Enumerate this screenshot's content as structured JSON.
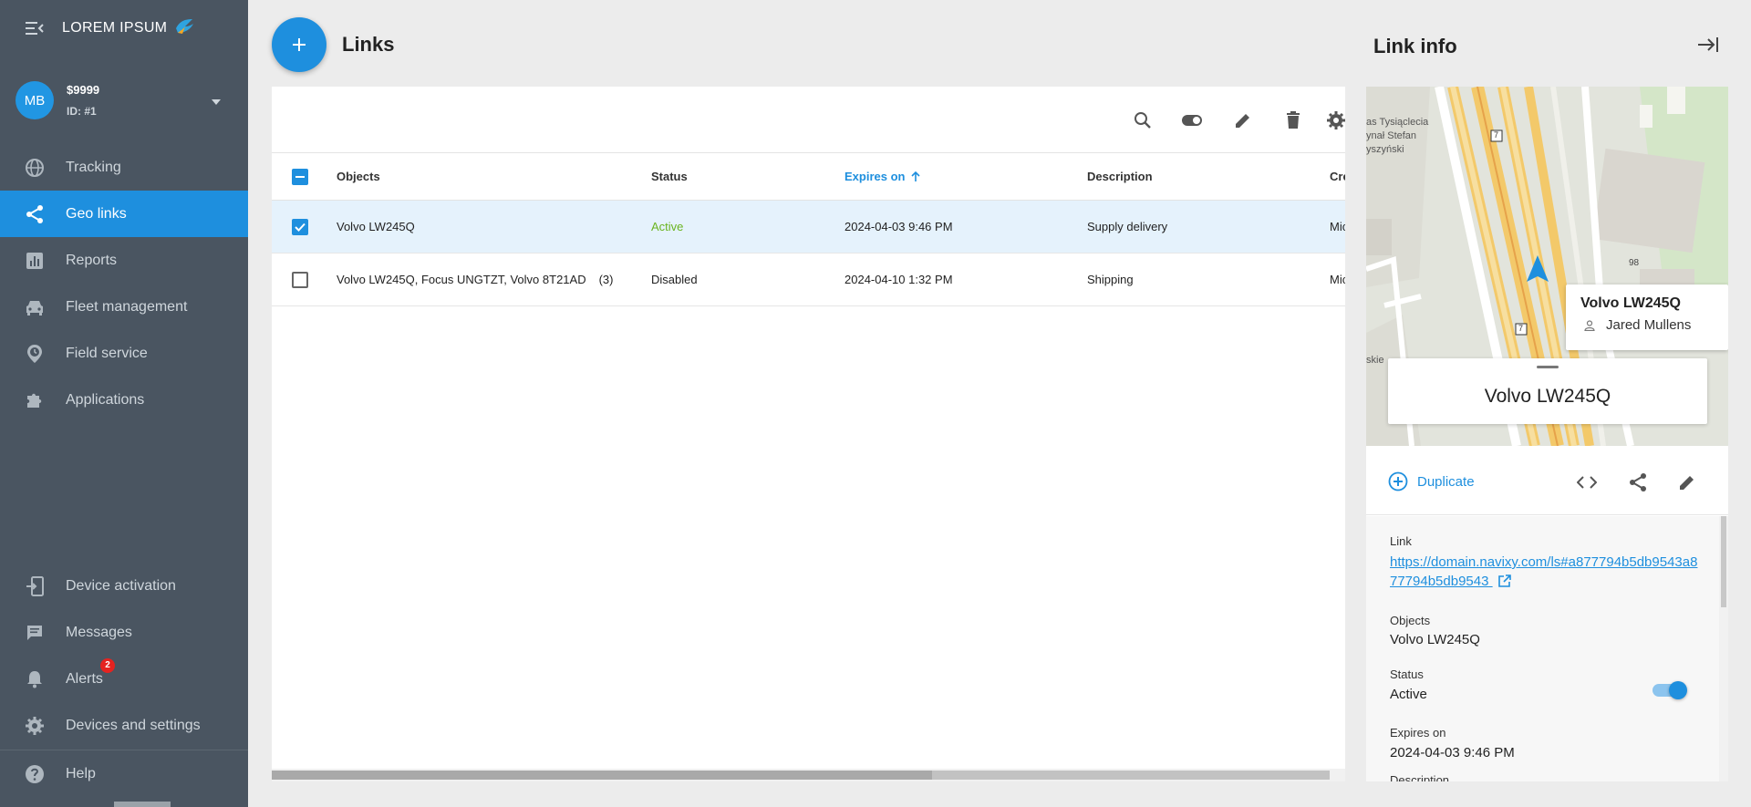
{
  "brand": {
    "name": "LOREM IPSUM"
  },
  "account": {
    "initials": "MB",
    "balance": "$9999",
    "id_label": "ID: #1"
  },
  "sidebar": {
    "items": [
      {
        "label": "Tracking",
        "icon": "globe-icon"
      },
      {
        "label": "Geo links",
        "icon": "share-icon",
        "active": true
      },
      {
        "label": "Reports",
        "icon": "reports-icon"
      },
      {
        "label": "Fleet management",
        "icon": "car-icon"
      },
      {
        "label": "Field service",
        "icon": "location-clock-icon"
      },
      {
        "label": "Applications",
        "icon": "puzzle-icon"
      }
    ],
    "bottom": [
      {
        "label": "Device activation",
        "icon": "device-activation-icon"
      },
      {
        "label": "Messages",
        "icon": "message-icon"
      },
      {
        "label": "Alerts",
        "icon": "bell-icon",
        "badge": "2"
      },
      {
        "label": "Devices and settings",
        "icon": "gear-icon"
      }
    ],
    "help": {
      "label": "Help",
      "icon": "help-icon"
    }
  },
  "main": {
    "title": "Links",
    "columns": [
      "Objects",
      "Status",
      "Expires on",
      "Description",
      "Created"
    ],
    "rows": [
      {
        "objects": "Volvo LW245Q",
        "count": "",
        "status": "Active",
        "expires": "2024-04-03 9:46 PM",
        "description": "Supply delivery",
        "created": "Michael",
        "checked": true
      },
      {
        "objects": "Volvo LW245Q, Focus UNGTZT, Volvo 8T21AD",
        "count": "(3)",
        "status": "Disabled",
        "expires": "2024-04-10 1:32 PM",
        "description": "Shipping",
        "created": "Michael",
        "checked": false
      }
    ]
  },
  "panel": {
    "title": "Link info",
    "map": {
      "labels": [
        "as Tysiąclecia",
        "ynał Stefan",
        "yszyński",
        "skie",
        "98",
        "7",
        "7"
      ],
      "popup_title": "Volvo LW245Q",
      "popup_driver": "Jared Mullens",
      "sheet_title": "Volvo LW245Q"
    },
    "duplicate_label": "Duplicate",
    "details": {
      "link_label": "Link",
      "link_value": "https://domain.navixy.com/ls#a877794b5db9543a877794b5db9543",
      "objects_label": "Objects",
      "objects_value": "Volvo LW245Q",
      "status_label": "Status",
      "status_value": "Active",
      "expires_label": "Expires on",
      "expires_value": "2024-04-03 9:46 PM",
      "next_label": "Description"
    }
  },
  "colors": {
    "accent": "#1e8fde",
    "sidebar": "#4a5561",
    "active_status": "#6ab41f",
    "badge": "#e52320"
  }
}
